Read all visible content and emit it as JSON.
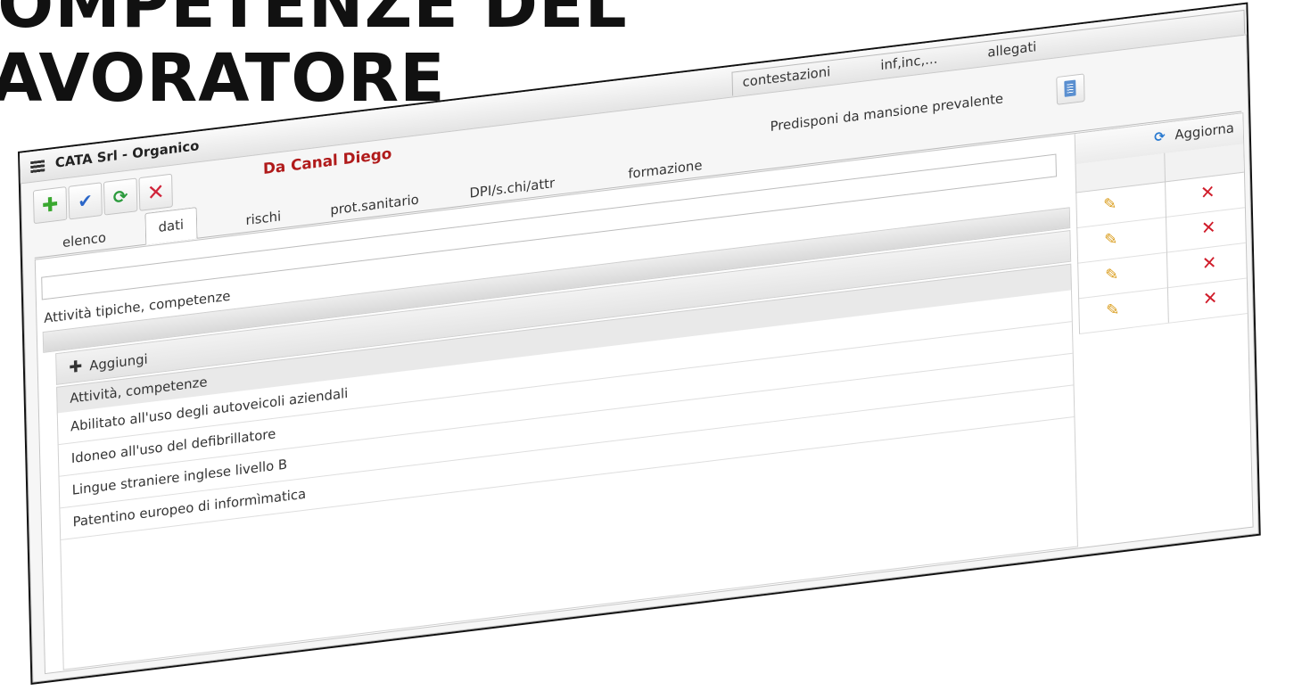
{
  "slide": {
    "title_lines": [
      "COMPETENZE DEL",
      "LAVORATORE"
    ]
  },
  "window": {
    "title": "CATA Srl - Organico",
    "top_tabs": [
      "contestazioni",
      "inf,inc,...",
      "allegati"
    ]
  },
  "toolbar": {
    "buttons": [
      "add-icon",
      "check-icon",
      "refresh-icon",
      "close-icon"
    ]
  },
  "person": {
    "name": "Da Canal Diego"
  },
  "tabs": [
    {
      "label": "elenco"
    },
    {
      "label": "dati"
    },
    {
      "label": "rischi"
    },
    {
      "label": "prot.sanitario"
    },
    {
      "label": "DPI/s.chi/attr"
    },
    {
      "label": "formazione"
    }
  ],
  "active_tab": "dati",
  "predisponi": {
    "label": "Predisponi da mansione prevalente"
  },
  "aggiorna": {
    "label": "Aggiorna"
  },
  "section": {
    "title": "Attività tipiche, competenze",
    "add_label": "Aggiungi",
    "list_header": "Attività, competenze",
    "items": [
      "Abilitato all'uso degli autoveicoli aziendali",
      "Idoneo all'uso del defibrillatore",
      "Lingue straniere inglese livello B",
      "Patentino europeo di informìmatica"
    ]
  },
  "colors": {
    "accent_red": "#b01a1a",
    "delete_red": "#d01c2a",
    "pencil": "#d99a16",
    "refresh_blue": "#2a7ad0"
  }
}
